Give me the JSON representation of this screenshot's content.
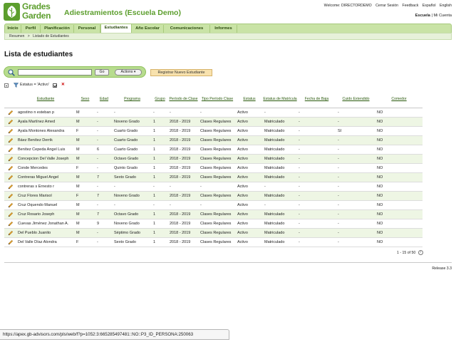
{
  "header": {
    "logo_line1": "Grades",
    "logo_line2": "Garden",
    "app_title": "Adiestramientos (Escuela Demo)",
    "toplinks": [
      "Welcome: DIRECTORDEMO",
      "Cerrar Sesión",
      "Feedback",
      "Español",
      "English"
    ],
    "account": {
      "school": "Escuela",
      "separator": "|",
      "account": "Mi Cuenta"
    }
  },
  "nav": {
    "tabs": [
      {
        "label": "Inicio"
      },
      {
        "label": "Perfil"
      },
      {
        "label": "Planificación"
      },
      {
        "label": "Personal"
      },
      {
        "label": "Estudiantes",
        "active": true
      },
      {
        "label": "Año Escolar"
      },
      {
        "label": "Comunicaciones"
      },
      {
        "label": "Informes"
      }
    ]
  },
  "breadcrumb": {
    "items": [
      "Resumen",
      "Listado de Estudiantes"
    ],
    "separator": ">"
  },
  "page_title": "Lista de estudiantes",
  "search": {
    "value": "",
    "go_label": "Go",
    "actions_label": "Actions"
  },
  "register_button": "Registrar Nuevo Estudiante",
  "filter": {
    "label": "Estatus = 'Activo'"
  },
  "table": {
    "columns": [
      "Estudiante",
      "Sexo",
      "Edad",
      "Programa",
      "Grupo",
      "Período de Clase",
      "Tipo Período Clase",
      "Estatus",
      "Estatus de Matrícula",
      "Fecha de Baja",
      "Cuido Extendido",
      "Comedor"
    ],
    "rows": [
      [
        "agostino n esteban p",
        "M",
        "-",
        "-",
        "-",
        "-",
        "-",
        "Activo",
        "-",
        "-",
        "-",
        "NO"
      ],
      [
        "Ayala Martínez Amed",
        "M",
        "-",
        "Noveno Grado",
        "1",
        "2018 - 2019",
        "Clases Regulares",
        "Activo",
        "Matriculado",
        "-",
        "-",
        "NO"
      ],
      [
        "Ayala Montones Alexandra",
        "F",
        "-",
        "Cuarto Grado",
        "1",
        "2018 - 2019",
        "Clases Regulares",
        "Activo",
        "Matriculado",
        "-",
        "SI",
        "NO"
      ],
      [
        "Báez Benítez Derrik",
        "M",
        "-",
        "Cuarto Grado",
        "1",
        "2018 - 2019",
        "Clases Regulares",
        "Activo",
        "Matriculado",
        "-",
        "-",
        "NO"
      ],
      [
        "Benítez Cepeda Angel Luis",
        "M",
        "6",
        "Cuarto Grado",
        "1",
        "2018 - 2019",
        "Clases Regulares",
        "Activo",
        "Matriculado",
        "-",
        "-",
        "NO"
      ],
      [
        "Concepcion Del Valle Joseph",
        "M",
        "-",
        "Octavo Grado",
        "1",
        "2018 - 2019",
        "Clases Regulares",
        "Activo",
        "Matriculado",
        "-",
        "-",
        "NO"
      ],
      [
        "Conde Mercedes",
        "F",
        "-",
        "Quinto Grado",
        "1",
        "2018 - 2019",
        "Clases Regulares",
        "Activo",
        "Matriculado",
        "-",
        "-",
        "NO"
      ],
      [
        "Contreras Miguel Angel",
        "M",
        "7",
        "Sexto Grado",
        "1",
        "2018 - 2019",
        "Clases Regulares",
        "Activo",
        "Matriculado",
        "-",
        "-",
        "NO"
      ],
      [
        "contreras s Ernesto r",
        "M",
        "-",
        "-",
        "-",
        "-",
        "-",
        "Activo",
        "-",
        "-",
        "-",
        "NO"
      ],
      [
        "Cruz Flores Marisol",
        "F",
        "7",
        "Noveno Grado",
        "1",
        "2018 - 2019",
        "Clases Regulares",
        "Activo",
        "Matriculado",
        "-",
        "-",
        "NO"
      ],
      [
        "Cruz Oquendo Manuel",
        "M",
        "-",
        "-",
        "-",
        "-",
        "-",
        "Activo",
        "-",
        "-",
        "-",
        "NO"
      ],
      [
        "Cruz Rosario Joseph",
        "M",
        "7",
        "Octavo Grado",
        "1",
        "2018 - 2019",
        "Clases Regulares",
        "Activo",
        "Matriculado",
        "-",
        "-",
        "NO"
      ],
      [
        "Cuevas Jiménez Jonathan A.",
        "M",
        "9",
        "Noveno Grado",
        "1",
        "2018 - 2019",
        "Clases Regulares",
        "Activo",
        "Matriculado",
        "-",
        "-",
        "NO"
      ],
      [
        "Del Pueblo Juanito",
        "M",
        "-",
        "Séptimo Grado",
        "1",
        "2018 - 2019",
        "Clases Regulares",
        "Activo",
        "Matriculado",
        "-",
        "-",
        "NO"
      ],
      [
        "Del Valle Díaz Alondra",
        "F",
        "-",
        "Sexto Grado",
        "1",
        "2018 - 2019",
        "Clases Regulares",
        "Activo",
        "Matriculado",
        "-",
        "-",
        "NO"
      ]
    ]
  },
  "pager": "1 - 15 of 50",
  "release": "Release 3.3",
  "statusbar_url": "https://apex.gb-advisors.com/pls/web/f?p=1052:3:665285497481::NO::P3_ID_PERSONA:250063",
  "colors": {
    "brand_green": "#5c9e2d",
    "nav_bg": "#c9e3a6",
    "row_alt": "#eef6e4",
    "register_bg": "#f8e2ae"
  },
  "icons": {
    "edit": "pencil-icon",
    "search": "magnifier-icon",
    "filter": "funnel-icon",
    "remove_filter": "remove-filter-icon",
    "next_page": "next-page-icon"
  }
}
